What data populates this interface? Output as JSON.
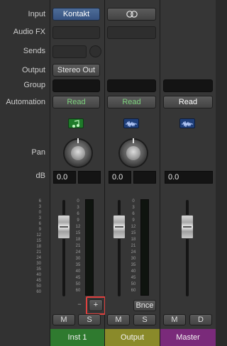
{
  "labels": {
    "input": "Input",
    "audio_fx": "Audio FX",
    "sends": "Sends",
    "output": "Output",
    "group": "Group",
    "automation": "Automation",
    "pan": "Pan",
    "db": "dB"
  },
  "strips": [
    {
      "input": "Kontakt",
      "output": "Stereo Out",
      "automation": "Read",
      "db": "0.0",
      "name": "Inst 1",
      "mute": "M",
      "solo": "S",
      "add_button": "+",
      "name_color": "#2f7a2f"
    },
    {
      "input_icon": "stereo-link-icon",
      "automation": "Read",
      "db": "0.0",
      "name": "Output",
      "mute": "M",
      "solo": "S",
      "bounce": "Bnce",
      "name_color": "#8a8a2a"
    },
    {
      "automation": "Read",
      "db": "0.0",
      "name": "Master",
      "mute": "M",
      "dim": "D",
      "name_color": "#7a2a7a"
    }
  ],
  "scale": [
    "6",
    "3",
    "0",
    "3",
    "6",
    "9",
    "12",
    "15",
    "18",
    "21",
    "24",
    "30",
    "35",
    "40",
    "45",
    "50",
    "60"
  ],
  "meter_scale": [
    "0",
    "3",
    "6",
    "9",
    "12",
    "15",
    "18",
    "21",
    "24",
    "30",
    "35",
    "40",
    "45",
    "50",
    "60"
  ],
  "colors": {
    "highlight": "#e0413f",
    "automation_green": "#7ed27e",
    "input_blue": "#4a6a98"
  }
}
